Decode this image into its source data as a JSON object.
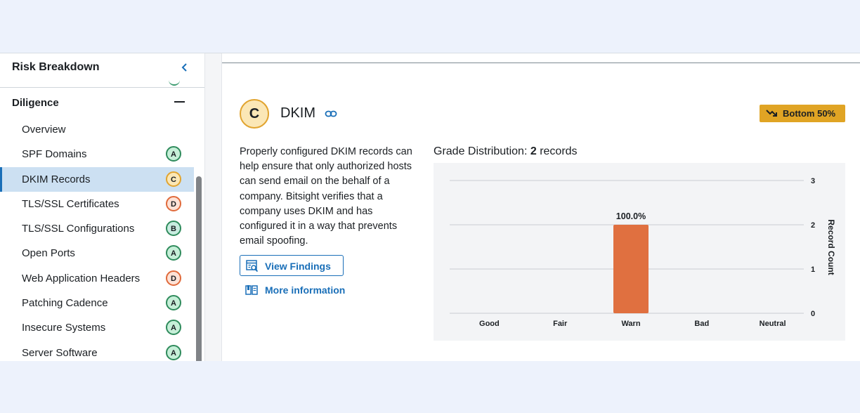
{
  "sidebar": {
    "title": "Risk Breakdown",
    "collapse_icon": "chevron-left-icon",
    "section": {
      "title": "Diligence",
      "toggle_icon": "minus-icon"
    },
    "items": [
      {
        "label": "Overview",
        "grade": ""
      },
      {
        "label": "SPF Domains",
        "grade": "A"
      },
      {
        "label": "DKIM Records",
        "grade": "C",
        "active": true
      },
      {
        "label": "TLS/SSL Certificates",
        "grade": "D"
      },
      {
        "label": "TLS/SSL Configurations",
        "grade": "B"
      },
      {
        "label": "Open Ports",
        "grade": "A"
      },
      {
        "label": "Web Application Headers",
        "grade": "D"
      },
      {
        "label": "Patching Cadence",
        "grade": "A"
      },
      {
        "label": "Insecure Systems",
        "grade": "A"
      },
      {
        "label": "Server Software",
        "grade": "A"
      }
    ]
  },
  "main": {
    "grade": "C",
    "title": "DKIM",
    "link_icon": "link-icon",
    "badge": {
      "label": "Bottom 50%",
      "icon": "trend-down-icon",
      "color": "#e0a424"
    },
    "description": "Properly configured DKIM records can help ensure that only authorized hosts can send email on the behalf of a company. Bitsight verifies that a company uses DKIM and has configured it in a way that prevents email spoofing.",
    "view_findings": {
      "label": "View Findings",
      "icon": "findings-icon"
    },
    "more_info": {
      "label": "More information",
      "icon": "book-icon"
    },
    "distribution": {
      "prefix": "Grade Distribution: ",
      "count": "2",
      "suffix": " records"
    }
  },
  "colors": {
    "accent": "#1a6fb8",
    "bar": "#e07040",
    "active_row": "#cce0f2"
  },
  "chart_data": {
    "type": "bar",
    "categories": [
      "Good",
      "Fair",
      "Warn",
      "Bad",
      "Neutral"
    ],
    "values": [
      0,
      0,
      2,
      0,
      0
    ],
    "data_labels": [
      "",
      "",
      "100.0%",
      "",
      ""
    ],
    "ylabel": "Record Count",
    "yticks": [
      "0",
      "1",
      "2",
      "3"
    ],
    "ylim": [
      0,
      3
    ],
    "y_axis_side": "right",
    "grid": true
  }
}
